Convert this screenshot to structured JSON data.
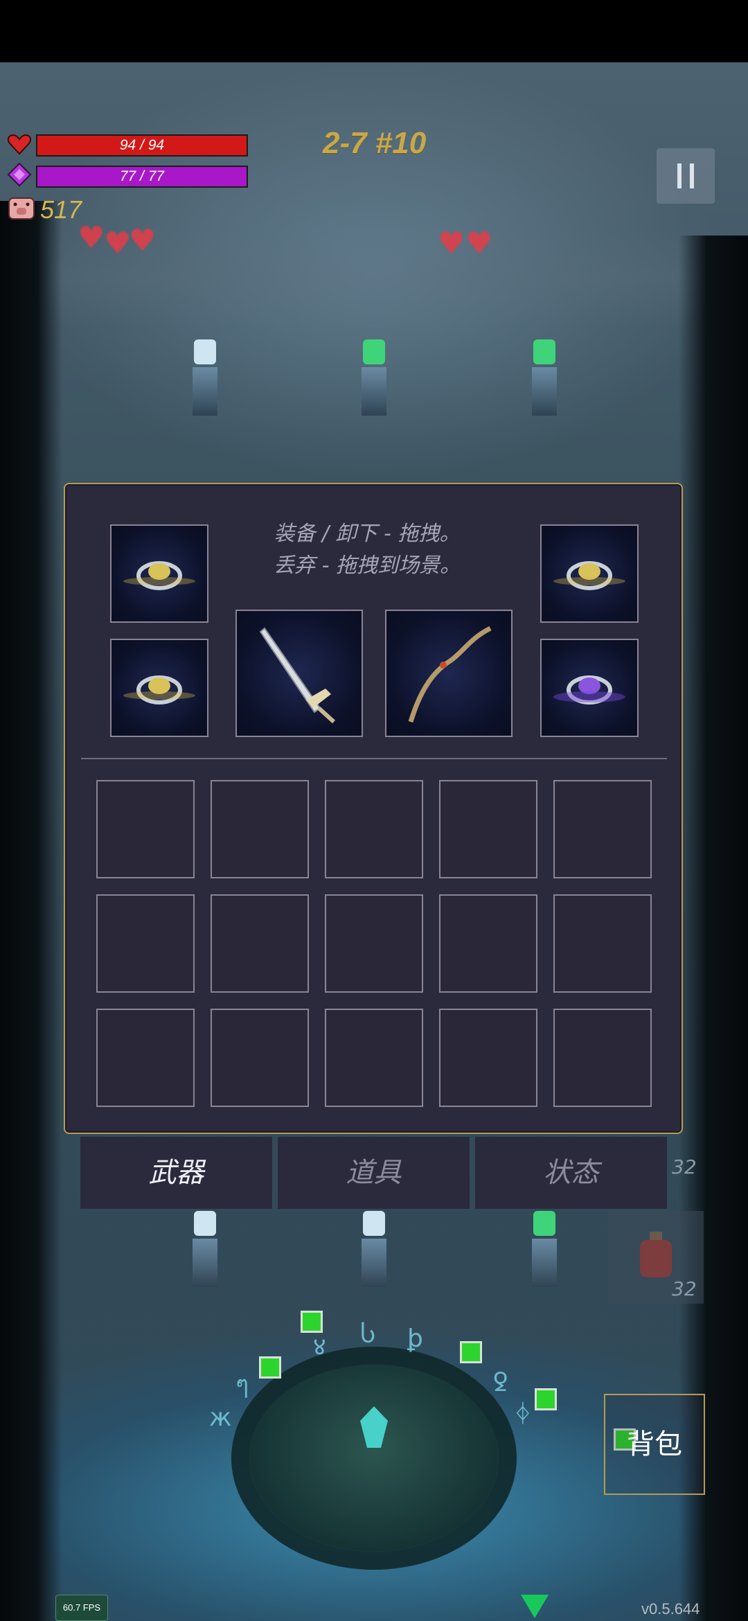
{
  "hud": {
    "hp": "94 / 94",
    "mp": "77 / 77",
    "gold": "517",
    "level": "2-7 #10",
    "hp_color": "#d31818",
    "mp_color": "#a817c8"
  },
  "inventory": {
    "hint_line1": "装备 / 卸下 - 拖拽。",
    "hint_line2": "丢弃 - 拖拽到场景。",
    "equipped": [
      "gold-ring",
      "gold-ring",
      "greatsword",
      "bow",
      "gold-ring",
      "purple-ring"
    ]
  },
  "tabs": [
    {
      "label": "武器",
      "active": true
    },
    {
      "label": "道具",
      "active": false
    },
    {
      "label": "状态",
      "active": false
    }
  ],
  "bag_button": "背包",
  "counts": {
    "upper": "32",
    "lower": "32"
  },
  "fps": "60.7 FPS",
  "version": "v0.5.644",
  "colors": {
    "panel": "#2b2a3d",
    "panel_border": "#b89a55",
    "level_text": "#c9a84a",
    "arrow": "#19c85a"
  }
}
